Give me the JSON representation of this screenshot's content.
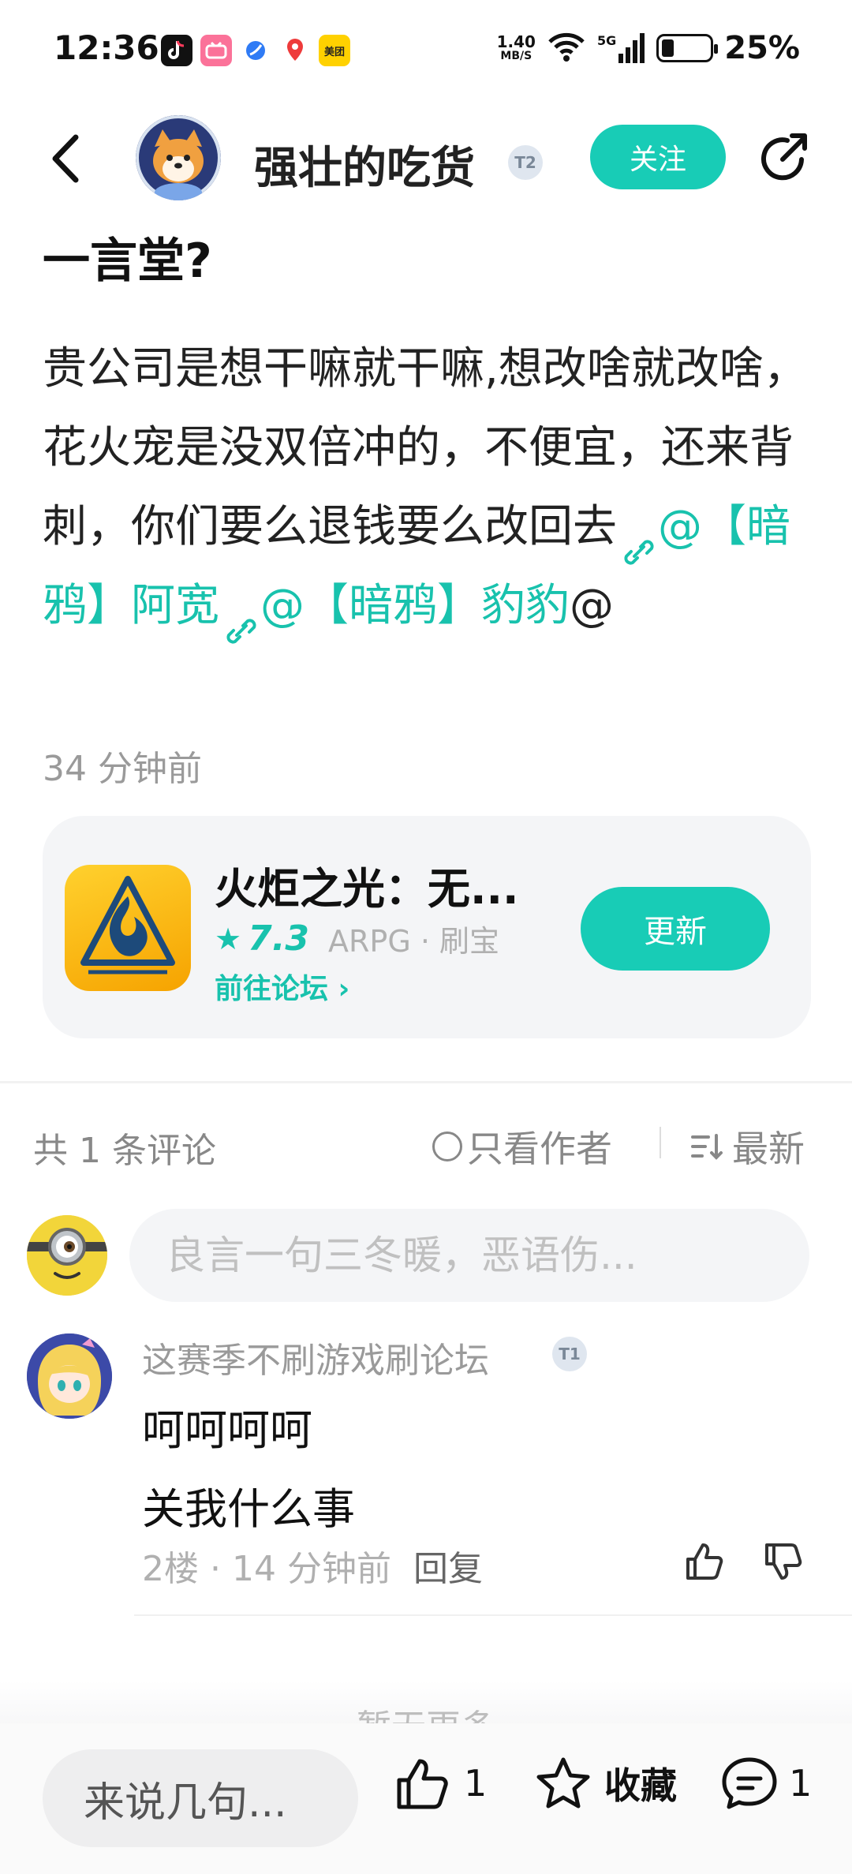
{
  "status_bar": {
    "time": "12:36",
    "network_speed": "1.40",
    "network_unit": "MB/S",
    "signal_type": "5G",
    "battery": "25%",
    "battery_level": 0.25,
    "meituan_label": "美团"
  },
  "header": {
    "author_name": "强壮的吃货",
    "author_badge": "T2",
    "follow_label": "关注"
  },
  "post": {
    "title": "一言堂?",
    "body_text": "贵公司是想干嘛就干嘛,想改啥就改啥，花火宠是没双倍冲的，不便宜，还来背刺，你们要么退钱要么改回去",
    "mention_1": "@【暗鸦】阿宽",
    "mention_2": "@【暗鸦】豹豹",
    "trailing_at": "@",
    "time": "34 分钟前"
  },
  "game_card": {
    "name": "火炬之光：无...",
    "rating": "7.3",
    "tags": "ARPG · 刷宝",
    "forum_link": "前往论坛 ›",
    "update_label": "更新"
  },
  "comments_header": {
    "count": "共 1 条评论",
    "author_only": "只看作者",
    "sort": "最新"
  },
  "comment_input": {
    "placeholder": "良言一句三冬暖，恶语伤..."
  },
  "comments": [
    {
      "username": "这赛季不刷游戏刷论坛",
      "badge": "T1",
      "line1": "呵呵呵呵",
      "line2": "关我什么事",
      "floor": "2楼",
      "time": "· 14 分钟前",
      "reply_label": "回复"
    }
  ],
  "no_more": "暂无更多",
  "bottom_bar": {
    "say_placeholder": "来说几句...",
    "like_count": "1",
    "favorite_label": "收藏",
    "comment_count": "1"
  },
  "colors": {
    "accent": "#18ccb6",
    "text_primary": "#111111",
    "text_secondary": "#9a9a9a"
  }
}
